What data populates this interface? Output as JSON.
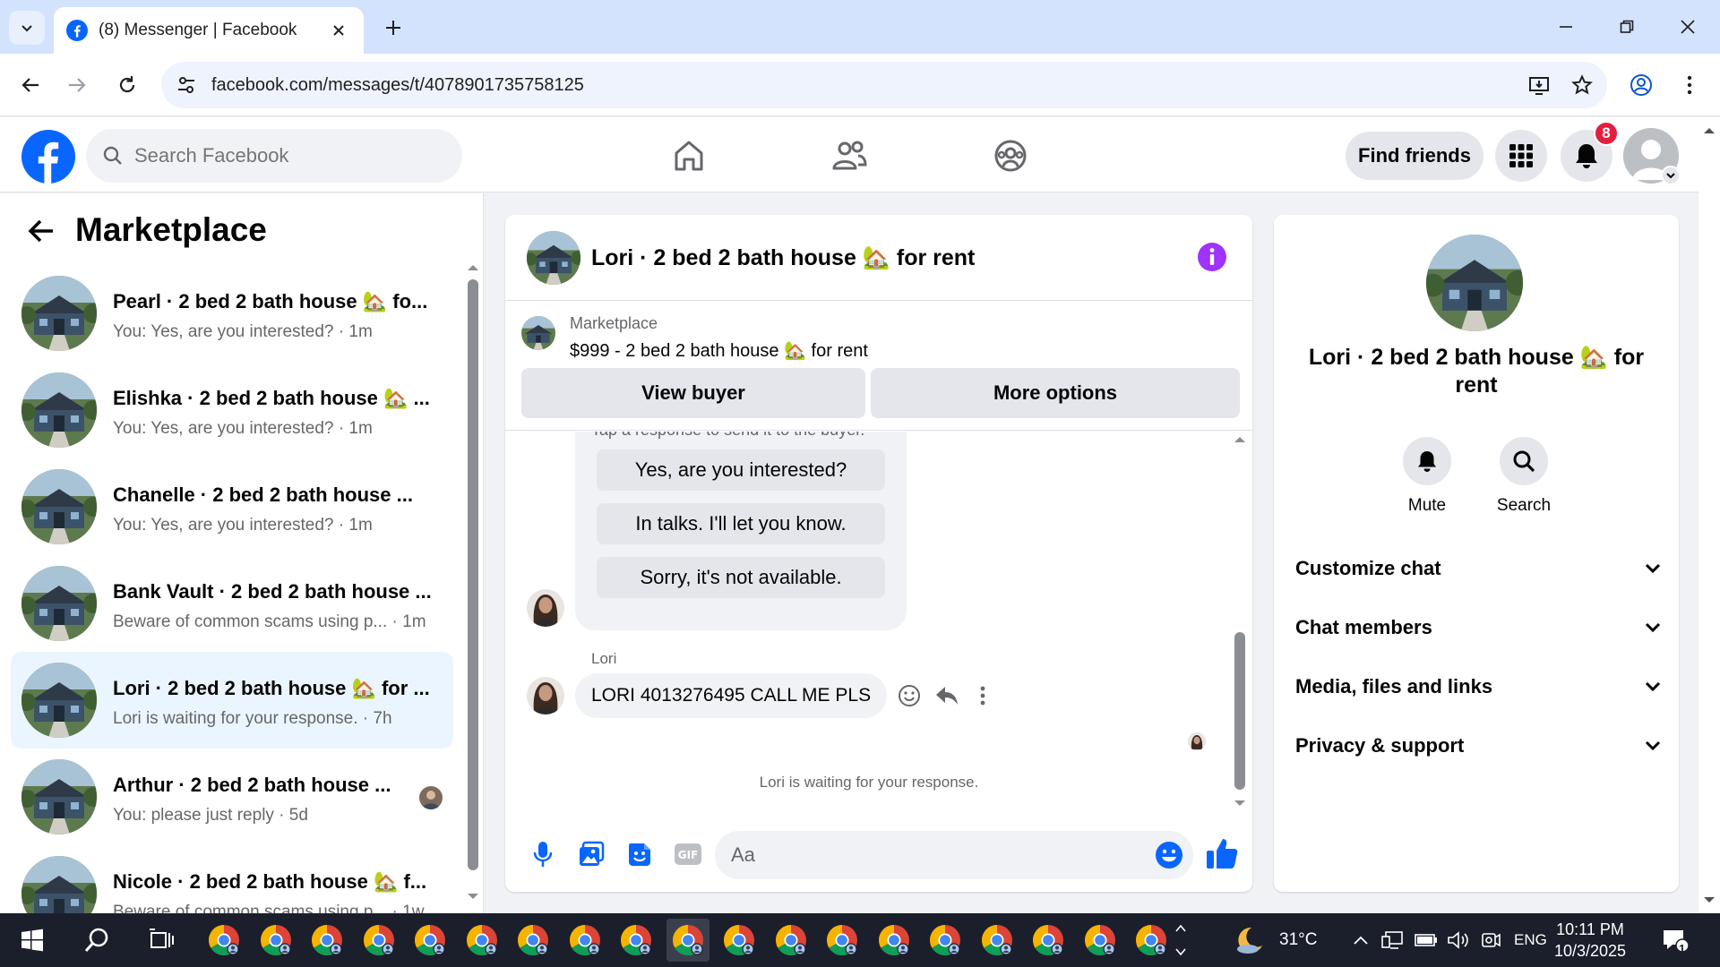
{
  "browser": {
    "tab_title": "(8) Messenger | Facebook",
    "url": "facebook.com/messages/t/4078901735758125"
  },
  "fb": {
    "search_placeholder": "Search Facebook",
    "find_friends": "Find friends",
    "notification_count": "8"
  },
  "left": {
    "title": "Marketplace",
    "chats": [
      {
        "name": "Pearl · 2 bed 2 bath house 🏡 fo...",
        "preview": "You: Yes, are you interested? · 1m"
      },
      {
        "name": "Elishka · 2 bed 2 bath house 🏡 ...",
        "preview": "You: Yes, are you interested? · 1m"
      },
      {
        "name": "Chanelle · 2 bed 2 bath house ...",
        "preview": "You: Yes, are you interested? · 1m"
      },
      {
        "name": "Bank Vault · 2 bed 2 bath house ...",
        "preview": "Beware of common scams using p... · 1m"
      },
      {
        "name": "Lori · 2 bed 2 bath house 🏡 for ...",
        "preview": "Lori is waiting for your response. · 7h"
      },
      {
        "name": "Arthur · 2 bed 2 bath house ...",
        "preview": "You: please just reply · 5d"
      },
      {
        "name": "Nicole · 2 bed 2 bath house 🏡 f...",
        "preview": "Beware of common scams using p... · 1w"
      }
    ]
  },
  "conversation": {
    "title": "Lori · 2 bed 2 bath house 🏡 for rent",
    "marketplace_label": "Marketplace",
    "listing": "$999 - 2 bed 2 bath house 🏡 for rent",
    "view_buyer": "View buyer",
    "more_options": "More options",
    "quick_hint": "Tap a response to send it to the buyer.",
    "quick_replies": [
      "Yes, are you interested?",
      "In talks. I'll let you know.",
      "Sorry, it's not available."
    ],
    "sender": "Lori",
    "message": "LORI 4013276495 CALL ME PLS",
    "waiting": "Lori is waiting for your response.",
    "composer_placeholder": "Aa"
  },
  "details": {
    "name": "Lori · 2 bed 2 bath house 🏡 for rent",
    "mute": "Mute",
    "search": "Search",
    "sections": [
      "Customize chat",
      "Chat members",
      "Media, files and links",
      "Privacy & support"
    ]
  },
  "taskbar": {
    "temperature": "31°C",
    "language": "ENG",
    "time": "10:11 PM",
    "date": "10/3/2025",
    "notification_count": "1"
  },
  "colors": {
    "fb_blue": "#0866ff",
    "accent_purple": "#a033ff",
    "active_chat": "#ebf5ff",
    "badge_red": "#e41e3f"
  }
}
